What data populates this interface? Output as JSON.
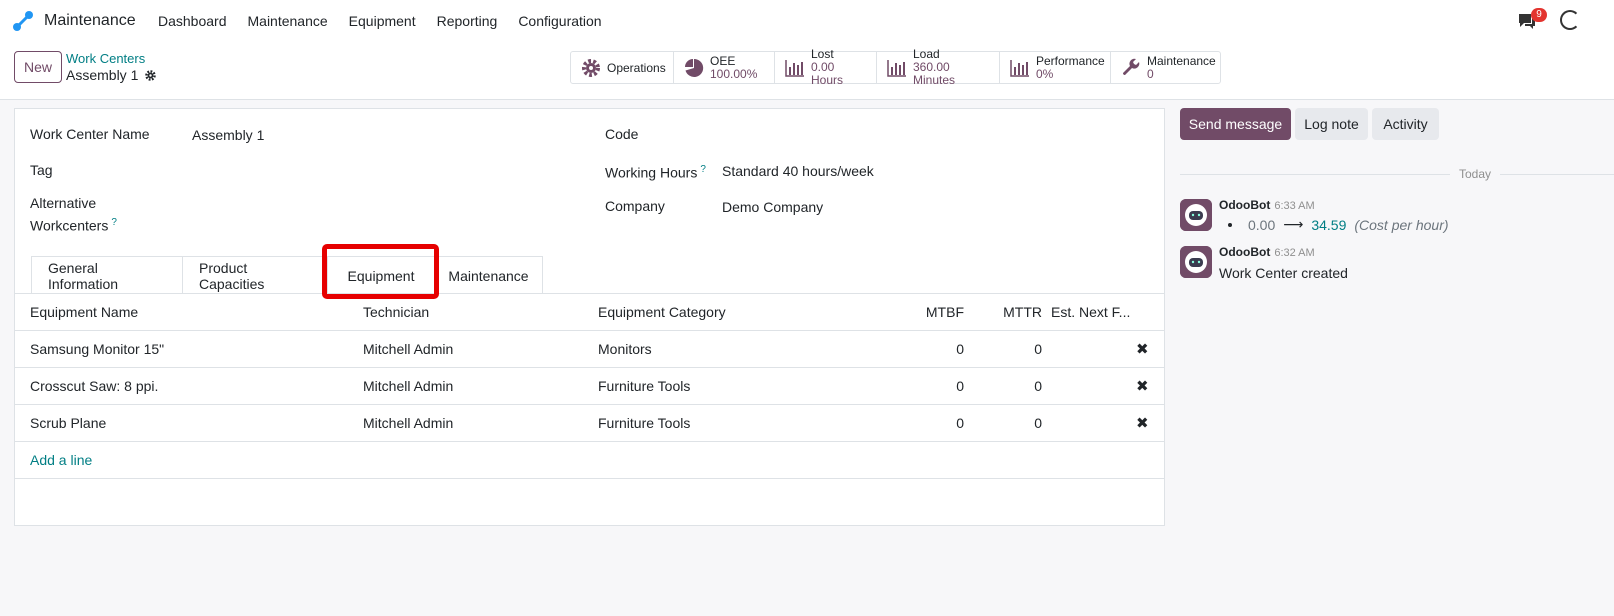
{
  "navbar": {
    "app_name": "Maintenance",
    "menu": [
      "Dashboard",
      "Maintenance",
      "Equipment",
      "Reporting",
      "Configuration"
    ],
    "notification_count": "9"
  },
  "control_panel": {
    "new_label": "New",
    "breadcrumb_parent": "Work Centers",
    "breadcrumb_current": "Assembly 1",
    "stats": [
      {
        "icon": "gear-icon",
        "label": "Operations",
        "value": ""
      },
      {
        "icon": "pie-chart-icon",
        "label": "OEE",
        "value": "100.00%"
      },
      {
        "icon": "bar-chart-icon",
        "label": "Lost",
        "value": "0.00 Hours"
      },
      {
        "icon": "bar-chart-icon",
        "label": "Load",
        "value": "360.00 Minutes"
      },
      {
        "icon": "bar-chart-icon",
        "label": "Performance",
        "value": "0%"
      },
      {
        "icon": "wrench-icon",
        "label": "Maintenance",
        "value": "0"
      }
    ]
  },
  "form": {
    "work_center_name_label": "Work Center Name",
    "work_center_name_value": "Assembly 1",
    "tag_label": "Tag",
    "alt_label_line1": "Alternative",
    "alt_label_line2": "Workcenters",
    "help_mark": "?",
    "code_label": "Code",
    "working_hours_label": "Working Hours",
    "working_hours_value": "Standard 40 hours/week",
    "company_label": "Company",
    "company_value": "Demo Company"
  },
  "tabs": [
    "General Information",
    "Product Capacities",
    "Equipment",
    "Maintenance"
  ],
  "active_tab": "Equipment",
  "table": {
    "headers": {
      "name": "Equipment Name",
      "technician": "Technician",
      "category": "Equipment Category",
      "mtbf": "MTBF",
      "mttr": "MTTR",
      "est": "Est. Next F..."
    },
    "rows": [
      {
        "name": "Samsung Monitor 15\"",
        "technician": "Mitchell Admin",
        "category": "Monitors",
        "mtbf": "0",
        "mttr": "0"
      },
      {
        "name": "Crosscut Saw: 8 ppi.",
        "technician": "Mitchell Admin",
        "category": "Furniture Tools",
        "mtbf": "0",
        "mttr": "0"
      },
      {
        "name": "Scrub Plane",
        "technician": "Mitchell Admin",
        "category": "Furniture Tools",
        "mtbf": "0",
        "mttr": "0"
      }
    ],
    "add_line": "Add a line",
    "delete_glyph": "✖"
  },
  "chatter": {
    "send_message": "Send message",
    "log_note": "Log note",
    "activity": "Activity",
    "today": "Today",
    "messages": [
      {
        "author": "OdooBot",
        "time": "6:33 AM",
        "old": "0.00",
        "arrow": "⟶",
        "new": "34.59",
        "field": "(Cost per hour)"
      },
      {
        "author": "OdooBot",
        "time": "6:32 AM",
        "body": "Work Center created"
      }
    ]
  },
  "colors": {
    "brand": "#714B67",
    "link": "#017e84",
    "highlight": "#e60000"
  }
}
